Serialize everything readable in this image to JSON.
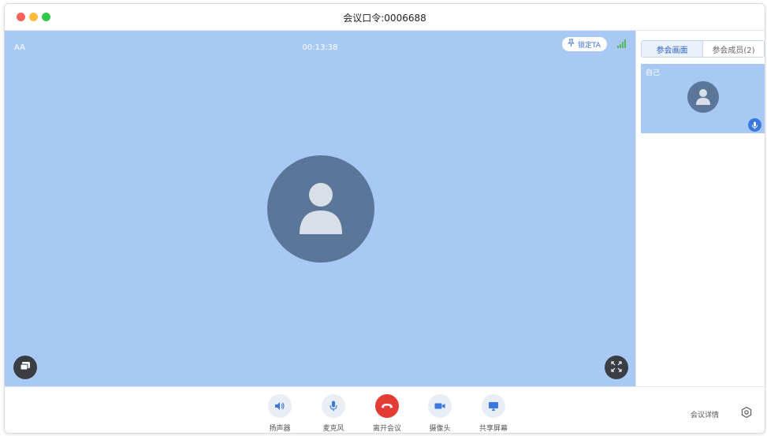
{
  "window": {
    "title": "会议口令:0006688"
  },
  "video": {
    "self_tag": "AA",
    "timer": "00:13:38",
    "lock_label": "锁定TA"
  },
  "panel": {
    "tabs": [
      {
        "label": "参会画面",
        "active": true
      },
      {
        "label": "参会成员(2)",
        "active": false
      }
    ],
    "thumbnail_label": "自己"
  },
  "toolbar": {
    "speaker_label": "扬声器",
    "mic_label": "麦克风",
    "leave_label": "离开会议",
    "camera_label": "摄像头",
    "share_label": "共享屏幕",
    "details_label": "会议详情"
  },
  "colors": {
    "video_bg": "#a8c9f4",
    "avatar_bg": "#5b7698",
    "accent": "#3a78e0",
    "hangup": "#e53b35",
    "signal": "#55b95a"
  },
  "icons": [
    "pin-icon",
    "signal-icon",
    "user-avatar-icon",
    "chat-icon",
    "fullscreen-icon",
    "microphone-icon",
    "speaker-icon",
    "hangup-icon",
    "camera-icon",
    "share-screen-icon",
    "gear-icon"
  ]
}
